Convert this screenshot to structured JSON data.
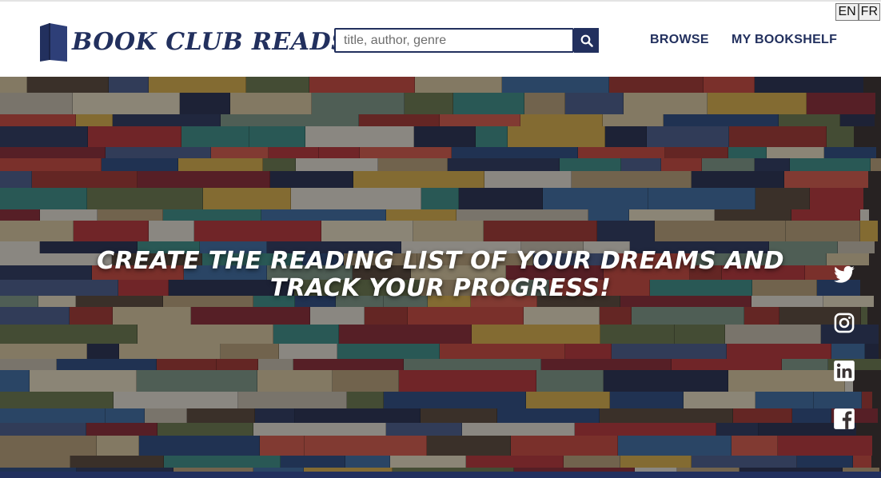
{
  "header": {
    "logo_text": "BOOK CLUB READS",
    "logo_icon": "book-logo-icon",
    "search": {
      "placeholder": "title, author, genre",
      "value": "",
      "button_icon": "search-icon"
    },
    "nav": [
      {
        "label": "BROWSE"
      },
      {
        "label": "MY BOOKSHELF"
      }
    ],
    "languages": [
      {
        "label": "EN"
      },
      {
        "label": "FR"
      }
    ]
  },
  "hero": {
    "title": "CREATE THE READING LIST OF YOUR DREAMS AND TRACK YOUR PROGRESS!",
    "background": "stacked-books-photo"
  },
  "social": [
    {
      "icon": "twitter-icon"
    },
    {
      "icon": "instagram-icon"
    },
    {
      "icon": "linkedin-icon"
    },
    {
      "icon": "facebook-icon"
    }
  ],
  "colors": {
    "brand": "#22305e",
    "hero_text": "#ffffff",
    "footer_bar": "#22305e"
  }
}
